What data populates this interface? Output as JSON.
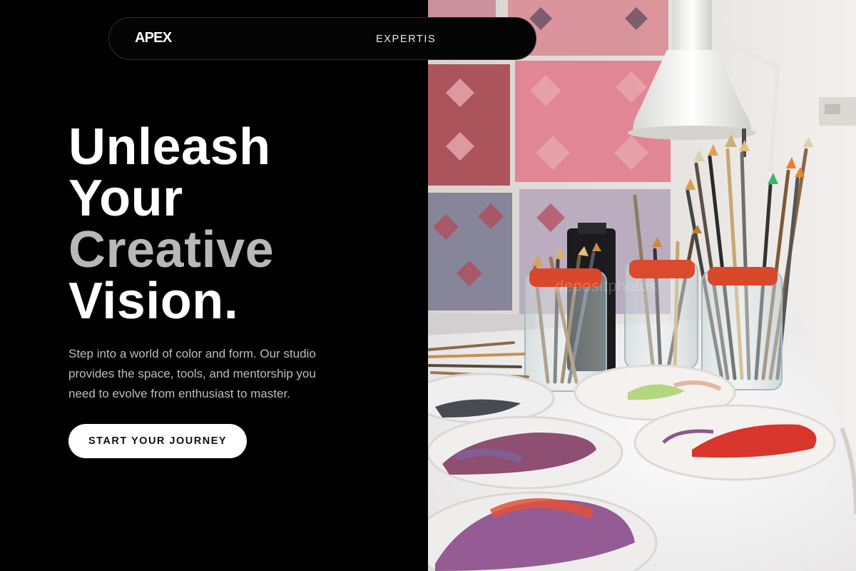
{
  "nav": {
    "logo": "APEX",
    "link_expertise": "EXPERTIS"
  },
  "hero": {
    "line1": "Unleash",
    "line2": "Your",
    "line3": "Creative",
    "line4": "Vision.",
    "description": "Step into a world of color and form. Our studio provides the space, tools, and mentorship you need to evolve from enthusiast to master.",
    "cta_label": "START YOUR JOURNEY"
  },
  "photo": {
    "watermark": "depositphotos"
  },
  "colors": {
    "background": "#000000",
    "heading": "#ffffff",
    "heading_muted": "#b8b8b8",
    "body_text": "#bdbdbd",
    "button_bg": "#ffffff"
  }
}
